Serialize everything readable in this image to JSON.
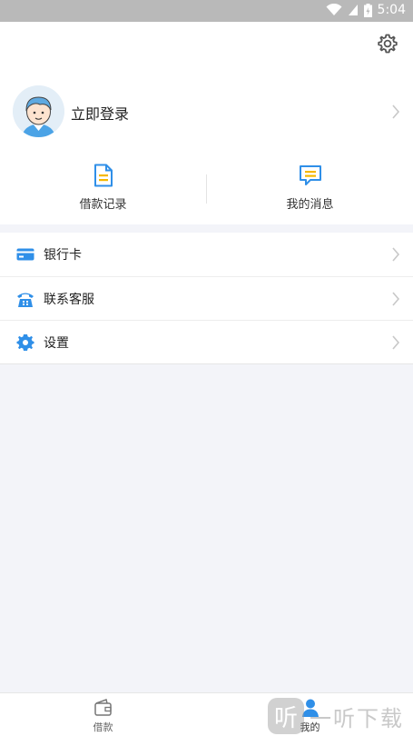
{
  "status_bar": {
    "time": "5:04"
  },
  "profile": {
    "login_label": "立即登录"
  },
  "quick_actions": [
    {
      "label": "借款记录",
      "icon": "document-icon",
      "color": "#2f8fe8"
    },
    {
      "label": "我的消息",
      "icon": "message-icon",
      "color": "#2f8fe8"
    }
  ],
  "menu": [
    {
      "label": "银行卡",
      "icon": "bank-card-icon"
    },
    {
      "label": "联系客服",
      "icon": "customer-service-phone-icon"
    },
    {
      "label": "设置",
      "icon": "settings-gear-icon"
    }
  ],
  "tab_bar": {
    "tabs": [
      {
        "label": "借款",
        "icon": "wallet-icon",
        "active": false
      },
      {
        "label": "我的",
        "icon": "person-icon",
        "active": true
      }
    ]
  },
  "watermark": {
    "logo_char": "听",
    "text": "一听下载"
  },
  "colors": {
    "accent": "#2f8fe8",
    "highlight": "#f5b800",
    "background": "#f3f4f9"
  }
}
